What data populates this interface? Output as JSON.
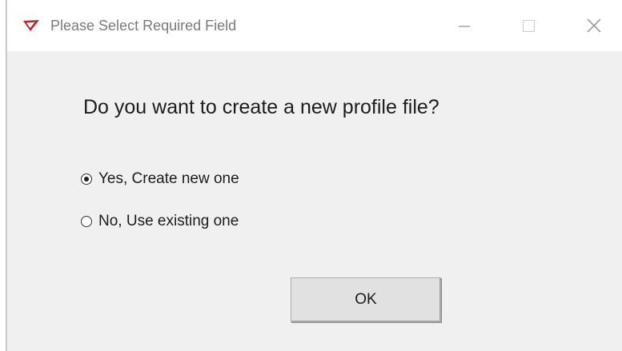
{
  "window": {
    "title": "Please Select Required Field",
    "app_icon": "red-arrow-logo-icon"
  },
  "title_controls": {
    "minimize_icon": "minimize-icon",
    "maximize_icon": "maximize-icon",
    "close_icon": "close-icon"
  },
  "dialog": {
    "question": "Do you want to create a new profile file?",
    "options": [
      {
        "label": "Yes, Create new one",
        "selected": true
      },
      {
        "label": "No, Use existing one",
        "selected": false
      }
    ],
    "ok_label": "OK"
  },
  "colors": {
    "dialog_background": "#f0f0f0",
    "titlebar_background": "#ffffff",
    "icon_red": "#c0232c"
  }
}
